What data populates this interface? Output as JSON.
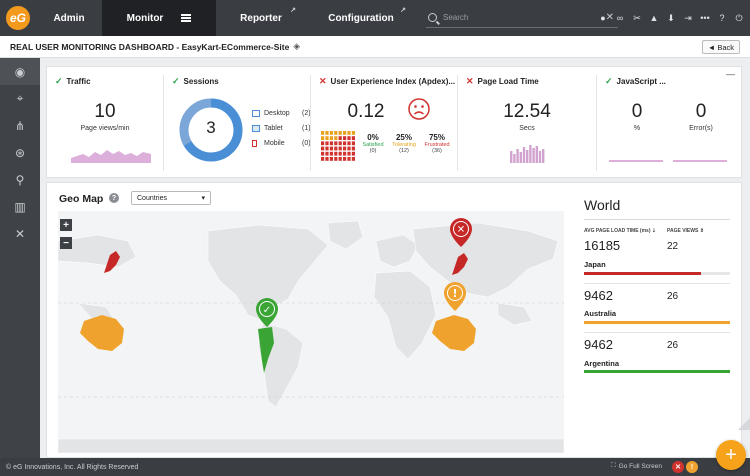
{
  "nav": {
    "admin": "Admin",
    "monitor": "Monitor",
    "reporter": "Reporter",
    "configuration": "Configuration",
    "search_placeholder": "Search"
  },
  "title": {
    "text": "REAL USER MONITORING DASHBOARD - EasyKart-ECommerce-Site",
    "back_label": "Back"
  },
  "tiles": {
    "traffic": {
      "title": "Traffic",
      "value": "10",
      "label": "Page views/min"
    },
    "sessions": {
      "title": "Sessions",
      "value": "3",
      "devices": [
        {
          "name": "Desktop",
          "count": "(2)"
        },
        {
          "name": "Tablet",
          "count": "(1)"
        },
        {
          "name": "Mobile",
          "count": "(0)"
        }
      ]
    },
    "apdex": {
      "title": "User Experience Index (Apdex)...",
      "value": "0.12",
      "cols": [
        {
          "pct": "0%",
          "cat": "Satisfied",
          "count": "(0)",
          "color": "#2ea44f"
        },
        {
          "pct": "25%",
          "cat": "Tolerating",
          "count": "(12)",
          "color": "#e8a21d"
        },
        {
          "pct": "75%",
          "cat": "Frustrated",
          "count": "(36)",
          "color": "#d0322e"
        }
      ]
    },
    "pageload": {
      "title": "Page Load Time",
      "value": "12.54",
      "label": "Secs"
    },
    "javascript": {
      "title": "JavaScript ...",
      "pct_value": "0",
      "pct_label": "%",
      "err_value": "0",
      "err_label": "Error(s)"
    }
  },
  "geo": {
    "title": "Geo Map",
    "selected": "Countries",
    "region_title": "World",
    "col_load": "AVG PAGE LOAD TIME (ms)",
    "col_views": "PAGE VIEWS",
    "rows": [
      {
        "load": "16185",
        "views": "22",
        "country": "Japan",
        "color": "#c62828",
        "level": 0.8
      },
      {
        "load": "9462",
        "views": "26",
        "country": "Australia",
        "color": "#f0a22e",
        "level": 1.0
      },
      {
        "load": "9462",
        "views": "26",
        "country": "Argentina",
        "color": "#3aa535",
        "level": 1.0
      }
    ]
  },
  "footer": {
    "copyright": "© eG Innovations, Inc. All Rights Reserved",
    "fullscreen": "Go Full Screen"
  },
  "colors": {
    "topbar": "#3a3d42",
    "accent": "#f7a21b",
    "donut": "#4a8fd6",
    "sparkline": "#d9a6d6"
  }
}
